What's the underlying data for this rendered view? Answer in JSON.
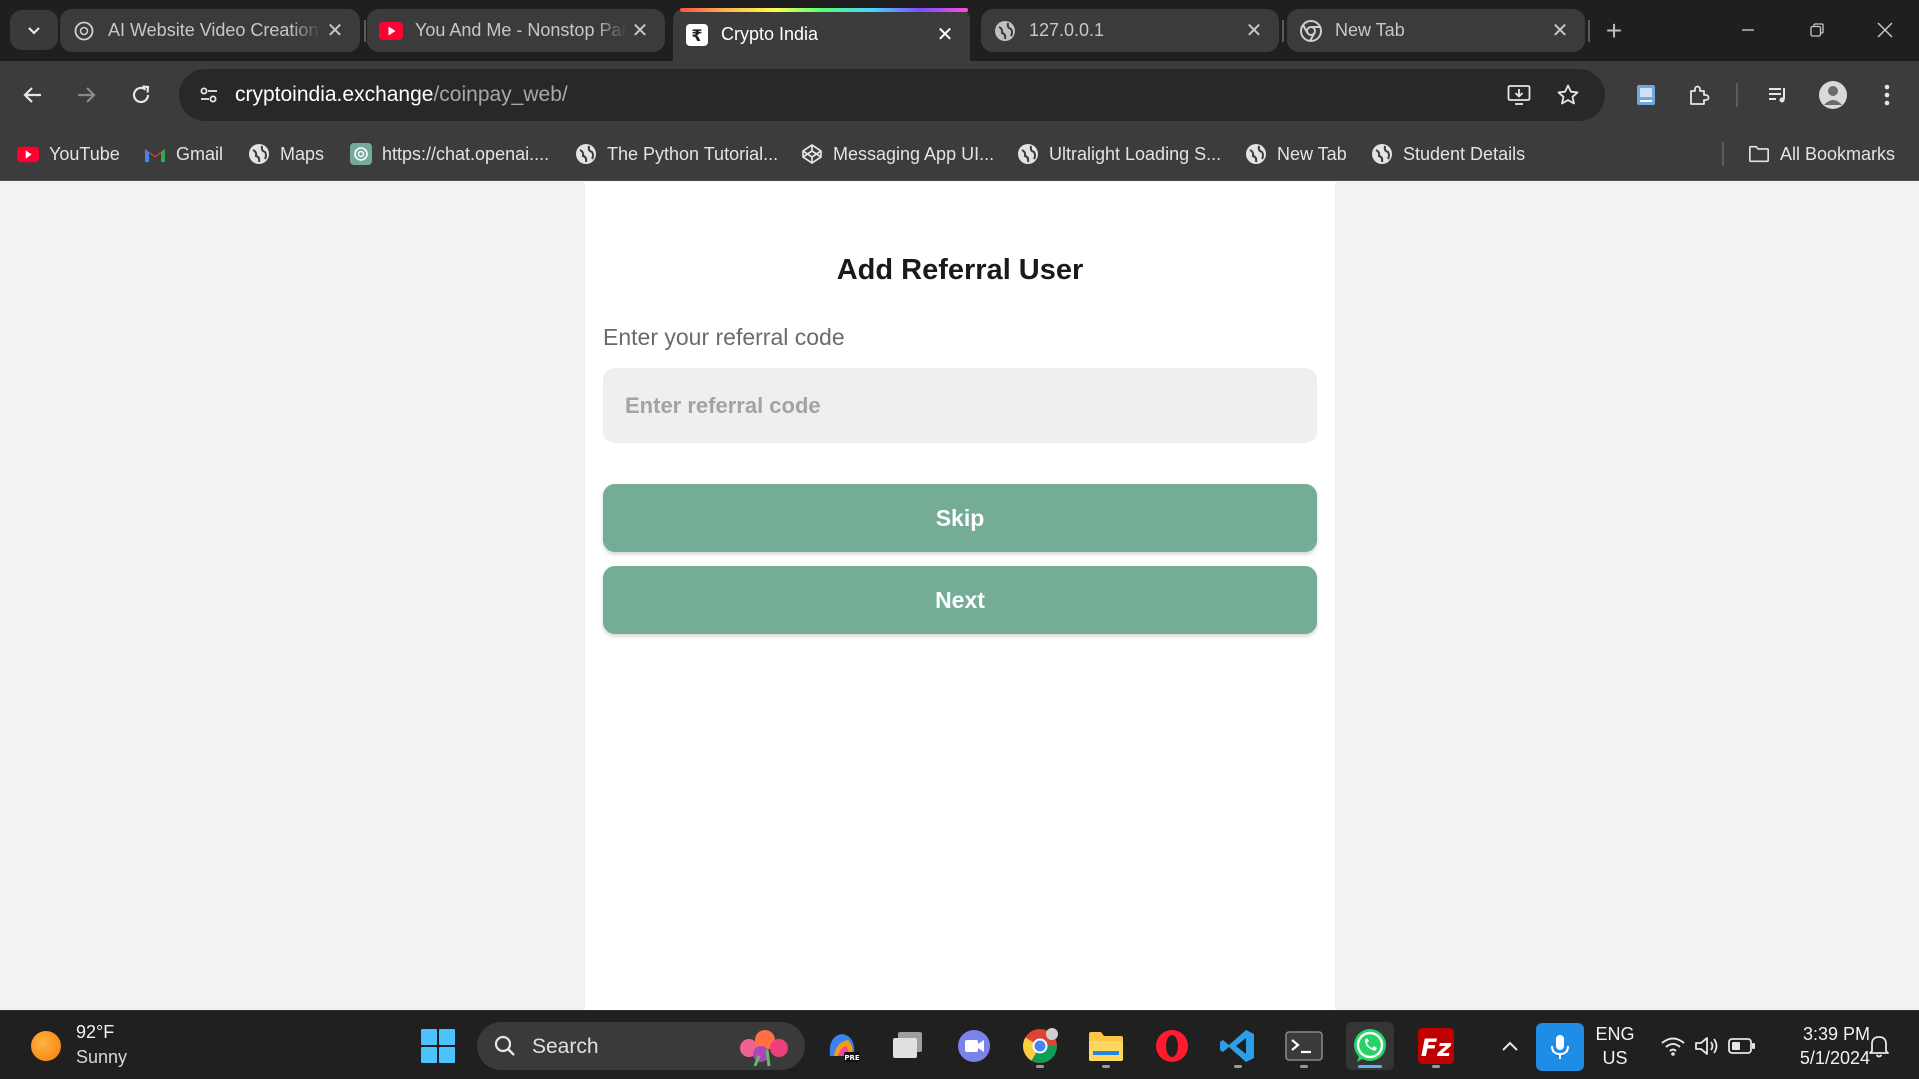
{
  "browser": {
    "tabs": [
      {
        "title": "AI Website Video Creation",
        "favicon": "chatgpt-icon",
        "active": false
      },
      {
        "title": "You And Me - Nonstop Party",
        "favicon": "youtube-icon",
        "active": false
      },
      {
        "title": "Crypto India",
        "favicon": "rupee-icon",
        "active": true
      },
      {
        "title": "127.0.0.1",
        "favicon": "globe-icon",
        "active": false
      },
      {
        "title": "New Tab",
        "favicon": "chrome-icon",
        "active": false
      }
    ],
    "address": {
      "host": "cryptoindia.exchange",
      "path": "/coinpay_web/"
    },
    "bookmarks": [
      {
        "label": "YouTube",
        "icon": "youtube-icon"
      },
      {
        "label": "Gmail",
        "icon": "gmail-icon"
      },
      {
        "label": "Maps",
        "icon": "globe-icon"
      },
      {
        "label": "https://chat.openai....",
        "icon": "chatgpt-icon"
      },
      {
        "label": "The Python Tutorial...",
        "icon": "globe-icon"
      },
      {
        "label": "Messaging App UI...",
        "icon": "codepen-icon"
      },
      {
        "label": "Ultralight Loading S...",
        "icon": "globe-icon"
      },
      {
        "label": "New Tab",
        "icon": "globe-icon"
      },
      {
        "label": "Student Details",
        "icon": "globe-icon"
      }
    ],
    "all_bookmarks_label": "All Bookmarks"
  },
  "page": {
    "title": "Add Referral User",
    "field_label": "Enter your referral code",
    "input_placeholder": "Enter referral code",
    "input_value": "",
    "skip_label": "Skip",
    "next_label": "Next",
    "accent_color": "#74ac96"
  },
  "taskbar": {
    "weather": {
      "temp": "92°F",
      "condition": "Sunny"
    },
    "search_label": "Search",
    "language": {
      "line1": "ENG",
      "line2": "US"
    },
    "clock": {
      "time": "3:39 PM",
      "date": "5/1/2024"
    }
  }
}
